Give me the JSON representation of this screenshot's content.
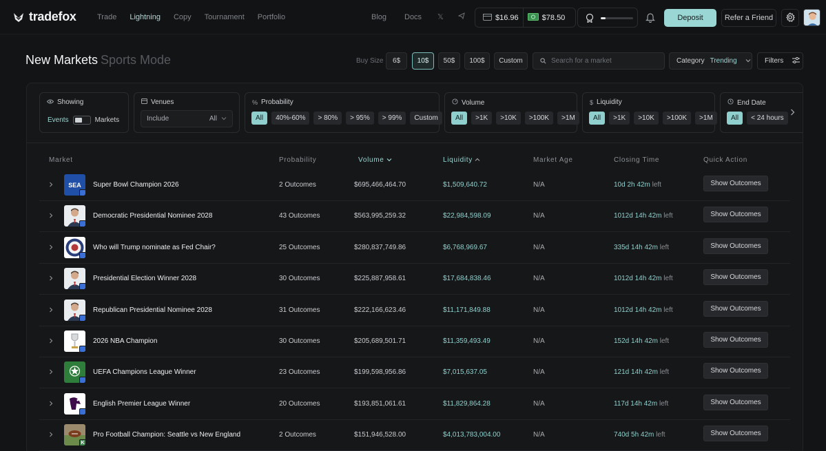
{
  "brand": {
    "name": "tradefox"
  },
  "nav": {
    "links": [
      "Trade",
      "Lightning",
      "Copy",
      "Tournament",
      "Portfolio"
    ],
    "active": "Lightning",
    "blog": "Blog",
    "docs": "Docs"
  },
  "wallet": {
    "balance_1": "$16.96",
    "balance_2": "$78.50"
  },
  "level": {
    "progress": 0.15
  },
  "actions": {
    "deposit": "Deposit",
    "refer": "Refer a Friend"
  },
  "header": {
    "title": "New Markets",
    "mode": "Sports Mode",
    "buy_size_label": "Buy Size",
    "buy_sizes": [
      "6$",
      "10$",
      "50$",
      "100$",
      "Custom"
    ],
    "buy_size_selected": "10$",
    "search_placeholder": "Search for a market",
    "category_label": "Category",
    "category_value": "Trending",
    "filters_label": "Filters"
  },
  "filters": {
    "showing": {
      "title": "Showing",
      "left": "Events",
      "right": "Markets"
    },
    "venues": {
      "title": "Venues",
      "mode": "Include",
      "value": "All"
    },
    "probability": {
      "title": "Probability",
      "chips": [
        "All",
        "40%-60%",
        "> 80%",
        "> 95%",
        "> 99%",
        "Custom"
      ]
    },
    "volume": {
      "title": "Volume",
      "chips": [
        "All",
        ">1K",
        ">10K",
        ">100K",
        ">1M"
      ]
    },
    "liquidity": {
      "title": "Liquidity",
      "chips": [
        "All",
        ">1K",
        ">10K",
        ">100K",
        ">1M"
      ]
    },
    "end_date": {
      "title": "End Date",
      "chips": [
        "All",
        "< 24 hours"
      ]
    }
  },
  "table": {
    "columns": [
      "Market",
      "Probability",
      "Volume",
      "Liquidity",
      "Market Age",
      "Closing Time",
      "Quick Action"
    ],
    "sort_volume": "desc",
    "sort_liquidity": "asc",
    "action_label": "Show Outcomes",
    "left_word": "left",
    "rows": [
      {
        "title": "Super Bowl Champion 2026",
        "outcomes": "2 Outcomes",
        "volume": "$695,466,464.70",
        "liquidity": "$1,509,640.72",
        "age": "N/A",
        "closing": "10d 2h 42m",
        "thumb": "sea",
        "thumb_text": "SEA"
      },
      {
        "title": "Democratic Presidential Nominee 2028",
        "outcomes": "43 Outcomes",
        "volume": "$563,995,259.32",
        "liquidity": "$22,984,598.09",
        "age": "N/A",
        "closing": "1012d 14h 42m",
        "thumb": "person"
      },
      {
        "title": "Who will Trump nominate as Fed Chair?",
        "outcomes": "25 Outcomes",
        "volume": "$280,837,749.86",
        "liquidity": "$6,768,969.67",
        "age": "N/A",
        "closing": "335d 14h 42m",
        "thumb": "seal"
      },
      {
        "title": "Presidential Election Winner 2028",
        "outcomes": "30 Outcomes",
        "volume": "$225,887,958.61",
        "liquidity": "$17,684,838.46",
        "age": "N/A",
        "closing": "1012d 14h 42m",
        "thumb": "person"
      },
      {
        "title": "Republican Presidential Nominee 2028",
        "outcomes": "31 Outcomes",
        "volume": "$222,166,623.46",
        "liquidity": "$11,171,849.88",
        "age": "N/A",
        "closing": "1012d 14h 42m",
        "thumb": "person"
      },
      {
        "title": "2026 NBA Champion",
        "outcomes": "30 Outcomes",
        "volume": "$205,689,501.71",
        "liquidity": "$11,359,493.49",
        "age": "N/A",
        "closing": "152d 14h 42m",
        "thumb": "trophy"
      },
      {
        "title": "UEFA Champions League Winner",
        "outcomes": "23 Outcomes",
        "volume": "$199,598,956.86",
        "liquidity": "$7,015,637.05",
        "age": "N/A",
        "closing": "121d 14h 42m",
        "thumb": "ucl"
      },
      {
        "title": "English Premier League Winner",
        "outcomes": "20 Outcomes",
        "volume": "$193,851,061.61",
        "liquidity": "$11,829,864.28",
        "age": "N/A",
        "closing": "117d 14h 42m",
        "thumb": "epl"
      },
      {
        "title": "Pro Football Champion: Seattle vs New England",
        "outcomes": "2 Outcomes",
        "volume": "$151,946,528.00",
        "liquidity": "$4,013,783,004.00",
        "age": "N/A",
        "closing": "740d 5h 42m",
        "thumb": "football",
        "badge_text": "K"
      }
    ]
  },
  "colors": {
    "accent": "#9ad6d4",
    "bg": "#131415",
    "panel": "#161718"
  }
}
